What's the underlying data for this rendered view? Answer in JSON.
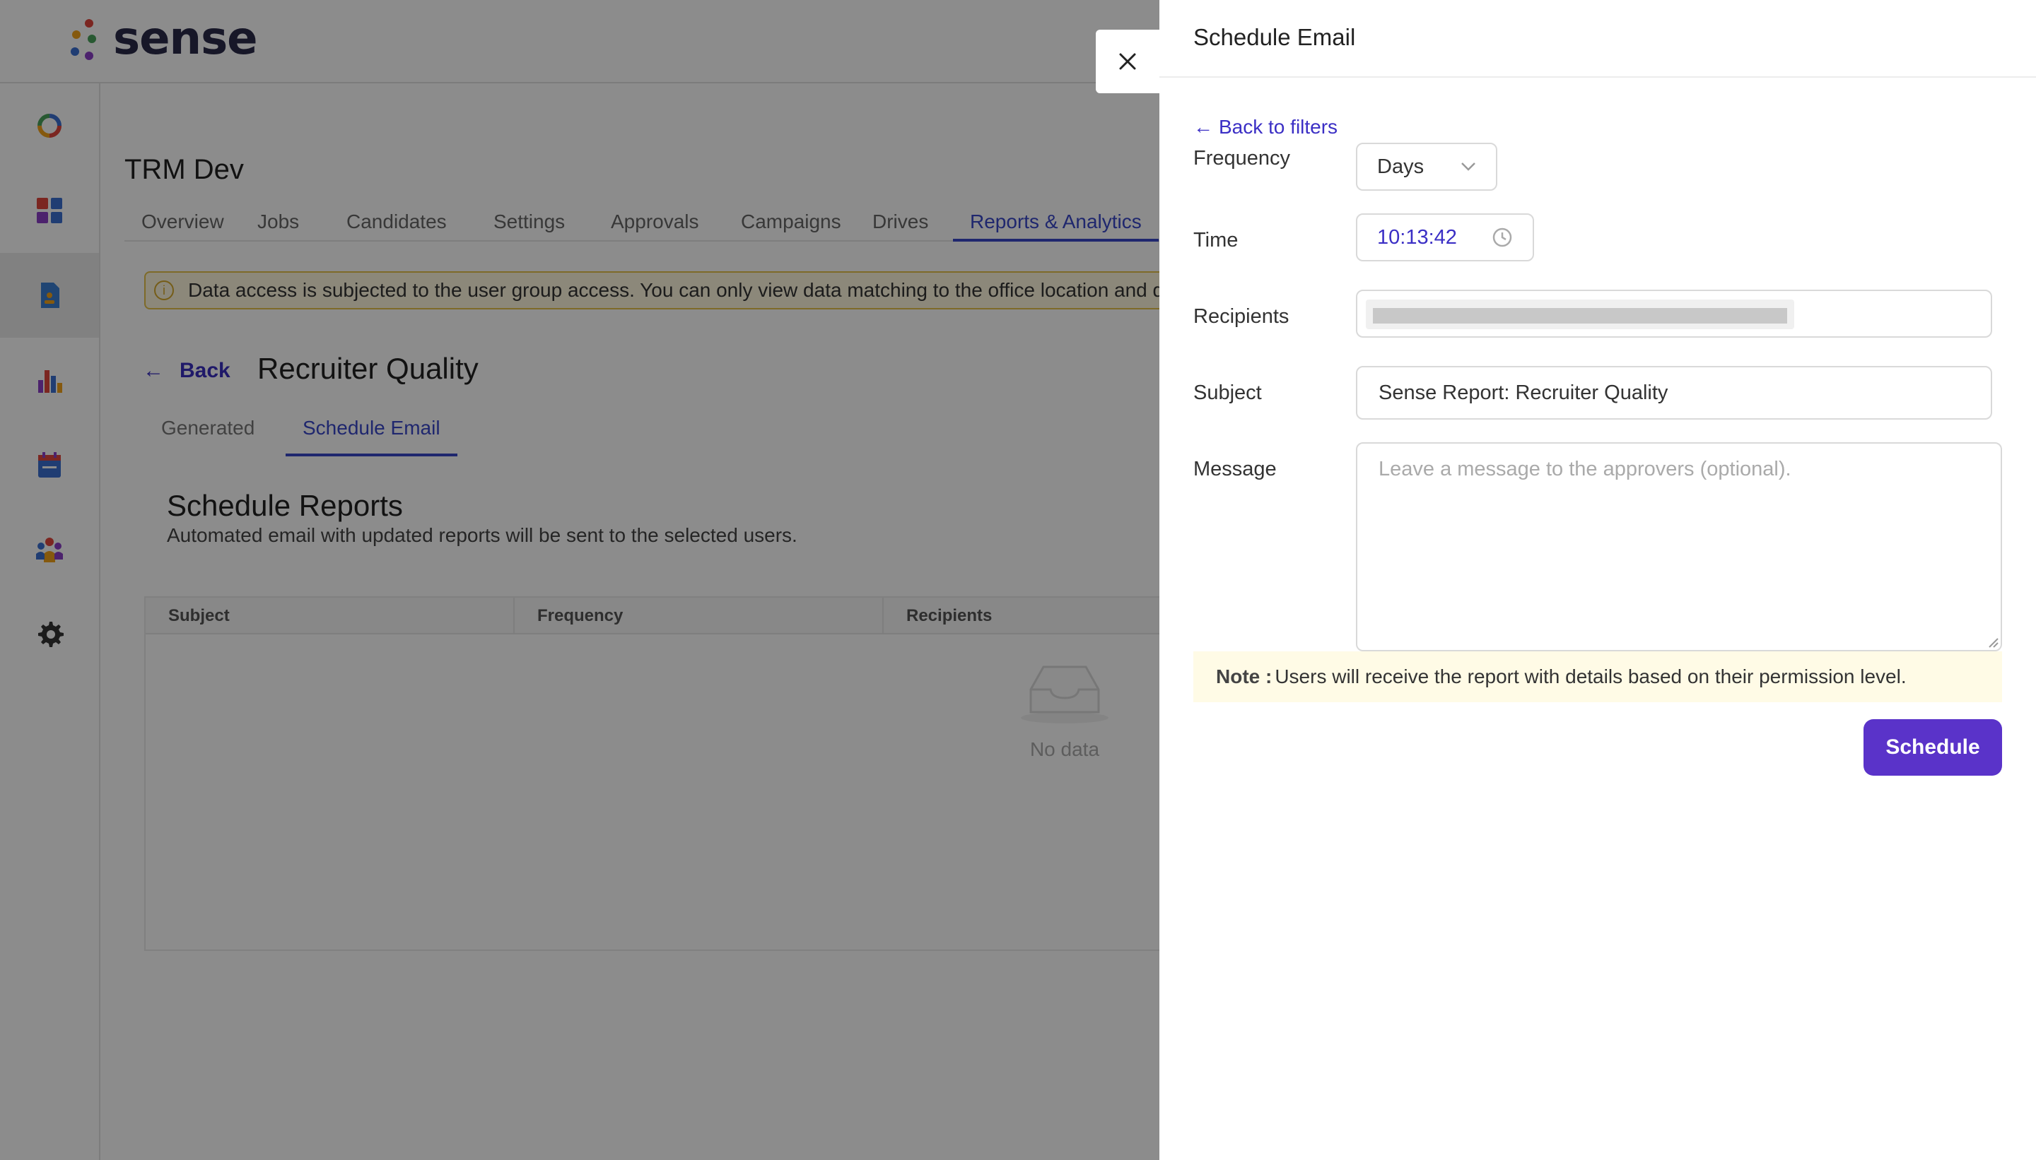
{
  "app": {
    "logo_text": "sense"
  },
  "sidebar": {
    "items": [
      {
        "icon": "loader-ring-icon"
      },
      {
        "icon": "dashboard-grid-icon"
      },
      {
        "icon": "reports-document-icon",
        "active": true
      },
      {
        "icon": "bar-chart-icon"
      },
      {
        "icon": "calendar-icon"
      },
      {
        "icon": "team-icon"
      },
      {
        "icon": "gear-icon"
      }
    ]
  },
  "main": {
    "org_title": "TRM Dev",
    "tabs": [
      {
        "label": "Overview"
      },
      {
        "label": "Jobs"
      },
      {
        "label": "Candidates"
      },
      {
        "label": "Settings"
      },
      {
        "label": "Approvals"
      },
      {
        "label": "Campaigns"
      },
      {
        "label": "Drives"
      },
      {
        "label": "Reports & Analytics",
        "active": true
      }
    ],
    "alert_text": "Data access is subjected to the user group access. You can only view data matching to the office location and de",
    "back_label": "Back",
    "page_title": "Recruiter Quality",
    "subtabs": [
      {
        "label": "Generated"
      },
      {
        "label": "Schedule Email",
        "active": true
      }
    ],
    "section_title": "Schedule Reports",
    "section_subtitle": "Automated email with updated reports will be sent to the selected users.",
    "table": {
      "columns": [
        "Subject",
        "Frequency",
        "Recipients"
      ],
      "empty_text": "No data"
    }
  },
  "drawer": {
    "title": "Schedule Email",
    "back_to_filters": "Back to filters",
    "frequency": {
      "label": "Frequency",
      "value": "Days"
    },
    "time": {
      "label": "Time",
      "value": "10:13:42"
    },
    "recipients": {
      "label": "Recipients"
    },
    "subject": {
      "label": "Subject",
      "value": "Sense Report: Recruiter Quality"
    },
    "message": {
      "label": "Message",
      "placeholder": "Leave a message to the approvers (optional)."
    },
    "note": {
      "prefix": "Note :",
      "text": "Users will receive the report with details based on their permission level."
    },
    "schedule_label": "Schedule"
  },
  "colors": {
    "accent": "#3a47c8",
    "primary_button": "#5a33c9",
    "link": "#3b2fc5",
    "note_bg": "#fffbe6",
    "alert_border": "#e6c24a"
  }
}
